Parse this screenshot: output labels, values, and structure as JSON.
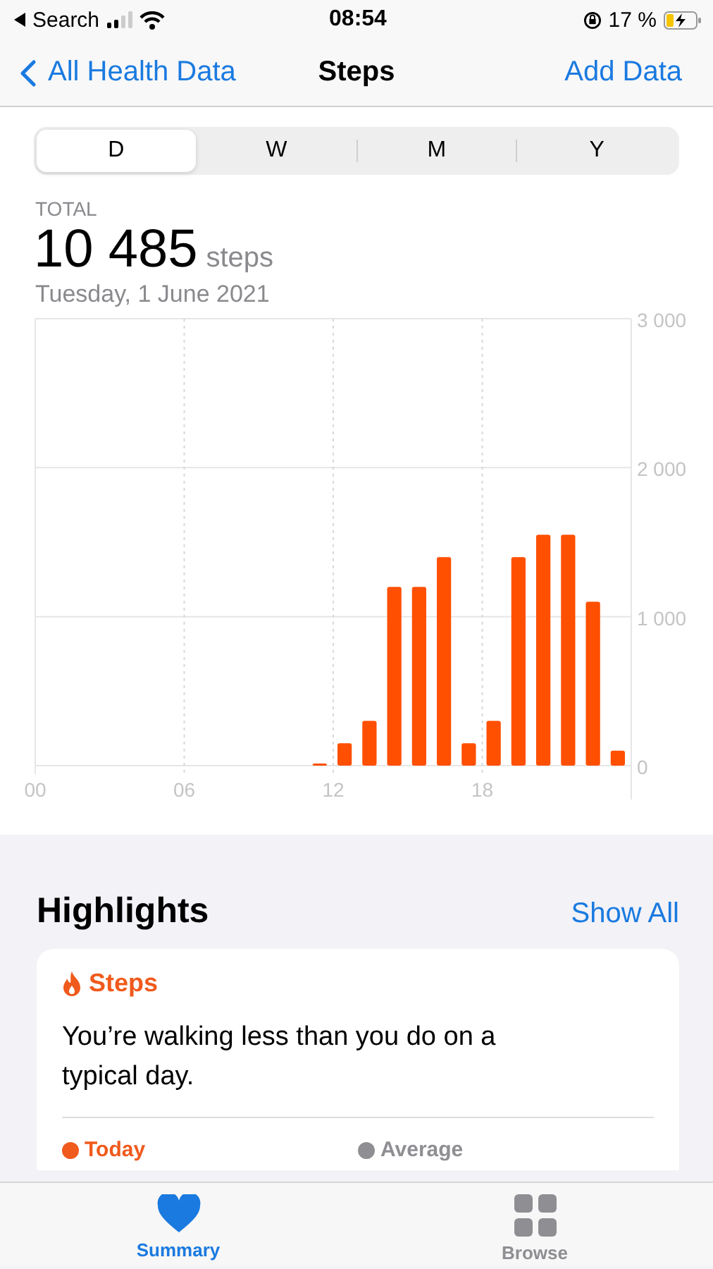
{
  "status_bar": {
    "back_label": "Search",
    "time": "08:54",
    "battery": "17 %"
  },
  "nav": {
    "back": "All Health Data",
    "title": "Steps",
    "action": "Add Data"
  },
  "segments": [
    {
      "label": "D",
      "selected": true
    },
    {
      "label": "W",
      "selected": false
    },
    {
      "label": "M",
      "selected": false
    },
    {
      "label": "Y",
      "selected": false
    }
  ],
  "summary": {
    "label": "TOTAL",
    "value": "10 485",
    "unit": "steps",
    "date": "Tuesday, 1 June 2021"
  },
  "chart_data": {
    "type": "bar",
    "x": [
      0.5,
      1.5,
      2.5,
      3.5,
      4.5,
      5.5,
      6.5,
      7.5,
      8.5,
      9.5,
      10.5,
      11.5,
      12.5,
      13.5,
      14.5,
      15.5,
      16.5,
      17.5,
      18.5,
      19.5,
      20.5,
      21.5,
      22.5,
      23.5
    ],
    "values": [
      0,
      0,
      0,
      0,
      0,
      0,
      0,
      0,
      0,
      0,
      0,
      10,
      150,
      300,
      1200,
      1200,
      1400,
      150,
      300,
      1400,
      1550,
      1550,
      1100,
      100
    ],
    "grid": true,
    "xlim": [
      0,
      24
    ],
    "ylim": [
      0,
      3000
    ],
    "yticks": [
      {
        "value": 0,
        "label": "0"
      },
      {
        "value": 1000,
        "label": "1 000"
      },
      {
        "value": 2000,
        "label": "2 000"
      },
      {
        "value": 3000,
        "label": "3 000"
      }
    ],
    "xticks": [
      {
        "value": 0,
        "label": "00"
      },
      {
        "value": 6,
        "label": "06"
      },
      {
        "value": 12,
        "label": "12"
      },
      {
        "value": 18,
        "label": "18"
      }
    ]
  },
  "highlights": {
    "title": "Highlights",
    "action": "Show All",
    "card": {
      "category": "Steps",
      "message": "You’re walking less than you do on a typical day.",
      "legend": [
        {
          "label": "Today",
          "color": "#f05a1c"
        },
        {
          "label": "Average",
          "color": "#8e8e93"
        }
      ]
    }
  },
  "tab_bar": [
    {
      "label": "Summary",
      "kind": "heart",
      "selected": true
    },
    {
      "label": "Browse",
      "kind": "grid",
      "selected": false
    }
  ]
}
